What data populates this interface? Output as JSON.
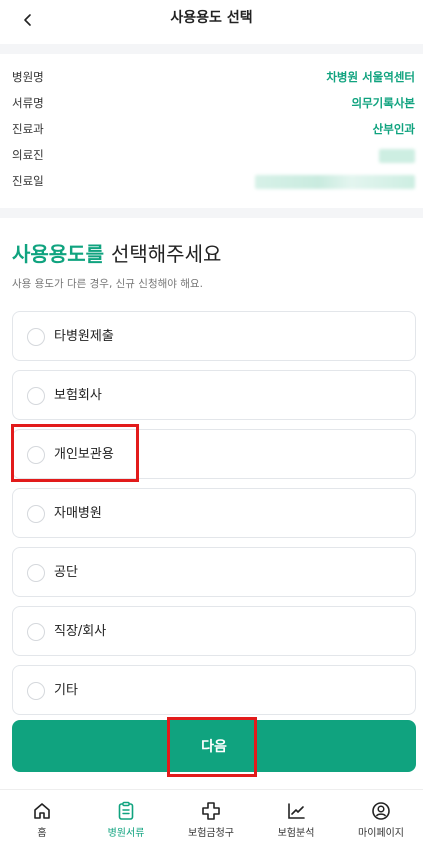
{
  "header": {
    "title": "사용용도 선택"
  },
  "info": {
    "rows": [
      {
        "label": "병원명",
        "value": "차병원 서울역센터"
      },
      {
        "label": "서류명",
        "value": "의무기록사본"
      },
      {
        "label": "진료과",
        "value": "산부인과"
      },
      {
        "label": "의료진",
        "value": ""
      },
      {
        "label": "진료일",
        "value": ""
      }
    ]
  },
  "selection": {
    "title_accent": "사용용도를",
    "title_rest": "선택해주세요",
    "subtitle": "사용 용도가 다른 경우, 신규 신청해야 해요.",
    "options": [
      "타병원제출",
      "보험회사",
      "개인보관용",
      "자매병원",
      "공단",
      "직장/회사",
      "기타"
    ]
  },
  "next_button": {
    "label": "다음"
  },
  "tabbar": {
    "active_index": 1,
    "tabs": [
      {
        "label": "홈",
        "icon": "home-icon"
      },
      {
        "label": "병원서류",
        "icon": "clipboard-icon"
      },
      {
        "label": "보험금청구",
        "icon": "cross-icon"
      },
      {
        "label": "보험분석",
        "icon": "chart-icon"
      },
      {
        "label": "마이페이지",
        "icon": "user-icon"
      }
    ]
  },
  "colors": {
    "accent": "#10a37f",
    "highlight": "#e21b1b"
  }
}
